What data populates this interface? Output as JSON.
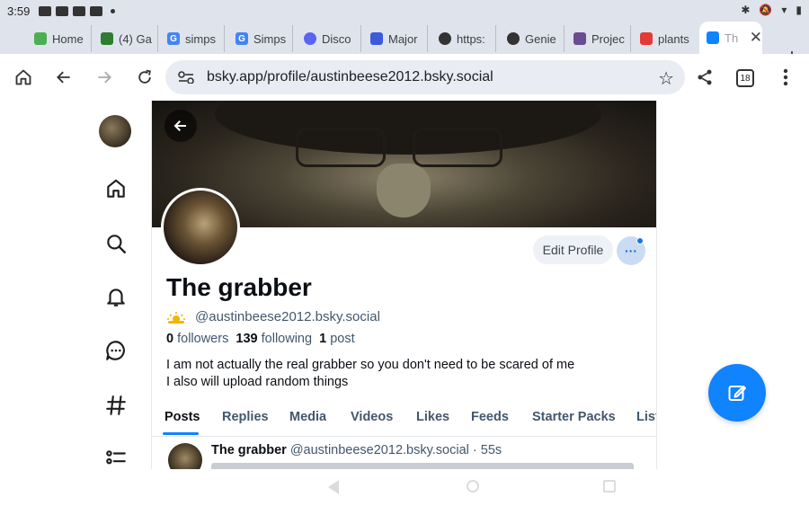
{
  "status_bar": {
    "time": "3:59"
  },
  "browser": {
    "tabs": [
      {
        "label": "Home",
        "color": "#4caf50",
        "glyph": ""
      },
      {
        "label": "(4) Ga",
        "color": "#2e7d32",
        "glyph": ""
      },
      {
        "label": "simps",
        "color": "#4285f4",
        "glyph": "G"
      },
      {
        "label": "Simps",
        "color": "#4285f4",
        "glyph": "G"
      },
      {
        "label": "Disco",
        "color": "#5865f2",
        "glyph": ""
      },
      {
        "label": "Major",
        "color": "#3b5bdb",
        "glyph": ""
      },
      {
        "label": "https:",
        "color": "#333333",
        "glyph": ""
      },
      {
        "label": "Genie",
        "color": "#333333",
        "glyph": ""
      },
      {
        "label": "Projec",
        "color": "#6a4c93",
        "glyph": ""
      },
      {
        "label": "plants",
        "color": "#e53935",
        "glyph": ""
      },
      {
        "label": "Th",
        "color": "#1083fe",
        "glyph": ""
      }
    ],
    "url": "bsky.app/profile/austinbeese2012.bsky.social",
    "tab_count": "18"
  },
  "profile": {
    "display_name": "The grabber",
    "handle": "@austinbeese2012.bsky.social",
    "followers_count": "0",
    "followers_label": "followers",
    "following_count": "139",
    "following_label": "following",
    "posts_count": "1",
    "posts_label": "post",
    "bio_line1": "I am not actually the real grabber so you don't need to be scared of me",
    "bio_line2": "I also will upload random things",
    "edit_profile_label": "Edit Profile",
    "more_label": "···"
  },
  "profile_tabs": [
    "Posts",
    "Replies",
    "Media",
    "Videos",
    "Likes",
    "Feeds",
    "Starter Packs",
    "List"
  ],
  "post": {
    "author": "The grabber",
    "handle": "@austinbeese2012.bsky.social",
    "time": "· 55s"
  },
  "colors": {
    "accent": "#1083fe",
    "text_secondary": "#42576c"
  }
}
